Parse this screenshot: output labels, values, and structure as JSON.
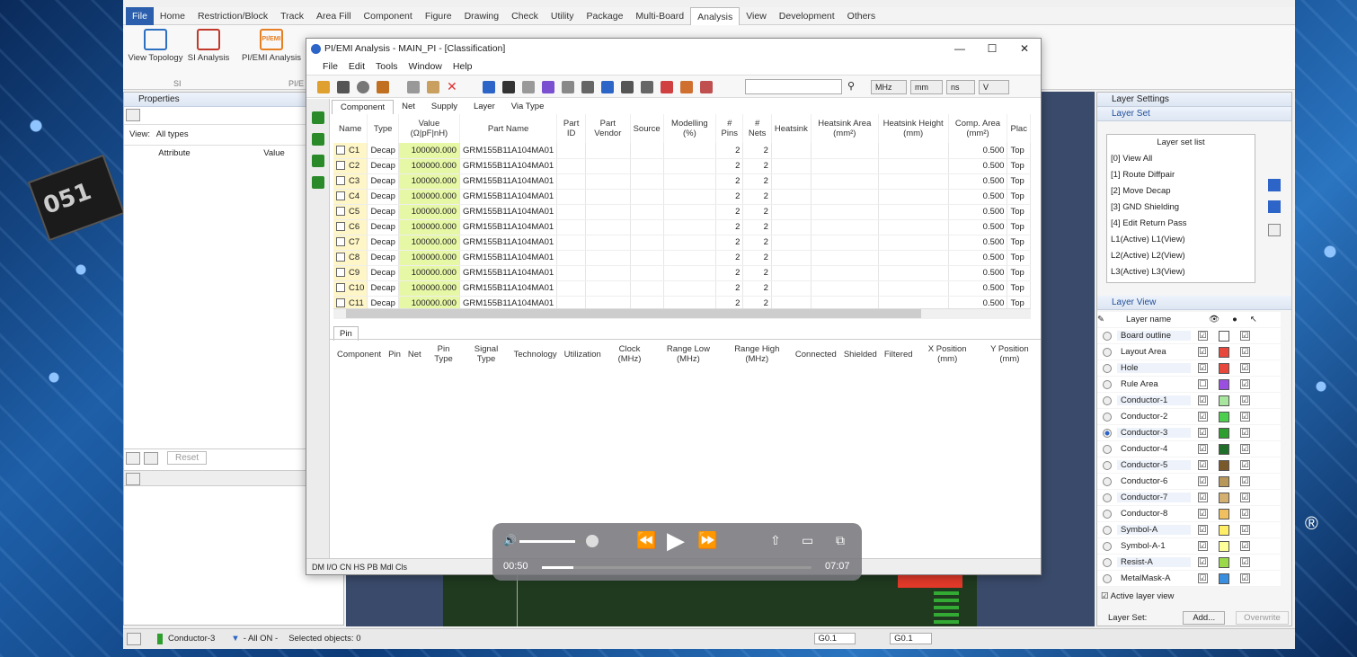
{
  "menu": {
    "tabs": [
      "File",
      "Home",
      "Restriction/Block",
      "Track",
      "Area Fill",
      "Component",
      "Figure",
      "Drawing",
      "Check",
      "Utility",
      "Package",
      "Multi-Board",
      "Analysis",
      "View",
      "Development",
      "Others"
    ],
    "active": "Analysis"
  },
  "ribbon": {
    "view_topology": "View Topology",
    "si_analysis": "SI Analysis",
    "pi_emi_analysis": "PI/EMI Analysis",
    "group_si": "SI",
    "group_pi": "PI/E"
  },
  "properties": {
    "title": "Properties",
    "view_label": "View:",
    "view_value": "All types",
    "col_attribute": "Attribute",
    "col_value": "Value",
    "reset": "Reset"
  },
  "dialog": {
    "title": "PI/EMI Analysis - MAIN_PI - [Classification]",
    "menu": [
      "File",
      "Edit",
      "Tools",
      "Window",
      "Help"
    ],
    "units": [
      "MHz",
      "mm",
      "ns",
      "V"
    ],
    "tabs": [
      "Component",
      "Net",
      "Supply",
      "Layer",
      "Via Type"
    ],
    "columns": [
      "Name",
      "Type",
      "Value (Ω|pF|nH)",
      "Part Name",
      "Part ID",
      "Part Vendor",
      "Source",
      "Modelling (%)",
      "# Pins",
      "# Nets",
      "Heatsink",
      "Heatsink Area (mm²)",
      "Heatsink Height (mm)",
      "Comp. Area (mm²)",
      "Plac"
    ],
    "rows": [
      {
        "name": "C1",
        "type": "Decap",
        "value": "100000.000",
        "part": "GRM155B11A104MA01",
        "pins": "2",
        "nets": "2",
        "area": "0.500",
        "place": "Top"
      },
      {
        "name": "C2",
        "type": "Decap",
        "value": "100000.000",
        "part": "GRM155B11A104MA01",
        "pins": "2",
        "nets": "2",
        "area": "0.500",
        "place": "Top"
      },
      {
        "name": "C3",
        "type": "Decap",
        "value": "100000.000",
        "part": "GRM155B11A104MA01",
        "pins": "2",
        "nets": "2",
        "area": "0.500",
        "place": "Top"
      },
      {
        "name": "C4",
        "type": "Decap",
        "value": "100000.000",
        "part": "GRM155B11A104MA01",
        "pins": "2",
        "nets": "2",
        "area": "0.500",
        "place": "Top"
      },
      {
        "name": "C5",
        "type": "Decap",
        "value": "100000.000",
        "part": "GRM155B11A104MA01",
        "pins": "2",
        "nets": "2",
        "area": "0.500",
        "place": "Top"
      },
      {
        "name": "C6",
        "type": "Decap",
        "value": "100000.000",
        "part": "GRM155B11A104MA01",
        "pins": "2",
        "nets": "2",
        "area": "0.500",
        "place": "Top"
      },
      {
        "name": "C7",
        "type": "Decap",
        "value": "100000.000",
        "part": "GRM155B11A104MA01",
        "pins": "2",
        "nets": "2",
        "area": "0.500",
        "place": "Top"
      },
      {
        "name": "C8",
        "type": "Decap",
        "value": "100000.000",
        "part": "GRM155B11A104MA01",
        "pins": "2",
        "nets": "2",
        "area": "0.500",
        "place": "Top"
      },
      {
        "name": "C9",
        "type": "Decap",
        "value": "100000.000",
        "part": "GRM155B11A104MA01",
        "pins": "2",
        "nets": "2",
        "area": "0.500",
        "place": "Top"
      },
      {
        "name": "C10",
        "type": "Decap",
        "value": "100000.000",
        "part": "GRM155B11A104MA01",
        "pins": "2",
        "nets": "2",
        "area": "0.500",
        "place": "Top"
      },
      {
        "name": "C11",
        "type": "Decap",
        "value": "100000.000",
        "part": "GRM155B11A104MA01",
        "pins": "2",
        "nets": "2",
        "area": "0.500",
        "place": "Top"
      }
    ],
    "pin_tab": "Pin",
    "pin_columns": [
      "Component",
      "Pin",
      "Net",
      "Pin Type",
      "Signal Type",
      "Technology",
      "Utilization",
      "Clock (MHz)",
      "Range Low (MHz)",
      "Range High (MHz)",
      "Connected",
      "Shielded",
      "Filtered",
      "X Position (mm)",
      "Y Position (mm)"
    ],
    "footer": "DM I/O CN HS PB Mdl Cls"
  },
  "layer_settings": {
    "title": "Layer Settings",
    "layer_set": "Layer Set",
    "list_header": "Layer set list",
    "sets": [
      "[0] View All",
      "[1] Route Diffpair",
      "[2] Move Decap",
      "[3] GND Shielding",
      "[4] Edit Return Pass",
      "L1(Active) L1(View)",
      "L2(Active) L2(View)",
      "L3(Active) L3(View)"
    ],
    "layer_view": "Layer View",
    "col_layer_name": "Layer name",
    "layers": [
      {
        "name": "Board outline",
        "vis": "☑",
        "sel": "☑",
        "color": "#ffffff",
        "checked_color": false,
        "active": false
      },
      {
        "name": "Layout Area",
        "vis": "☑",
        "sel": "☑",
        "color": "#e8473c",
        "active": false
      },
      {
        "name": "Hole",
        "vis": "☑",
        "sel": "☑",
        "color": "#e8473c",
        "active": false
      },
      {
        "name": "Rule Area",
        "vis": "☐",
        "sel": "☑",
        "color": "#9b4fe0",
        "active": false
      },
      {
        "name": "Conductor-1",
        "vis": "☑",
        "sel": "☑",
        "color": "#a8e6a0",
        "active": false
      },
      {
        "name": "Conductor-2",
        "vis": "☑",
        "sel": "☑",
        "color": "#4ccf4c",
        "active": false
      },
      {
        "name": "Conductor-3",
        "vis": "☑",
        "sel": "☑",
        "color": "#2e9e2e",
        "active": true
      },
      {
        "name": "Conductor-4",
        "vis": "☑",
        "sel": "☑",
        "color": "#1f6e2a",
        "active": false
      },
      {
        "name": "Conductor-5",
        "vis": "☑",
        "sel": "☑",
        "color": "#7a5a2a",
        "active": false
      },
      {
        "name": "Conductor-6",
        "vis": "☑",
        "sel": "☑",
        "color": "#b8975a",
        "active": false
      },
      {
        "name": "Conductor-7",
        "vis": "☑",
        "sel": "☑",
        "color": "#d4b070",
        "active": false
      },
      {
        "name": "Conductor-8",
        "vis": "☑",
        "sel": "☑",
        "color": "#f0c060",
        "active": false
      },
      {
        "name": "Symbol-A",
        "vis": "☑",
        "sel": "☑",
        "color": "#ffee66",
        "active": false
      },
      {
        "name": "Symbol-A-1",
        "vis": "☑",
        "sel": "☑",
        "color": "#ffff99",
        "active": false
      },
      {
        "name": "Resist-A",
        "vis": "☑",
        "sel": "☑",
        "color": "#9ad94a",
        "active": false
      },
      {
        "name": "MetalMask-A",
        "vis": "☑",
        "sel": "☑",
        "color": "#3a8ee0",
        "active": false
      }
    ],
    "active_layer_view": "Active layer view",
    "layer_set_label": "Layer Set:",
    "add": "Add...",
    "overwrite": "Overwrite"
  },
  "status": {
    "layer": "Conductor-3",
    "filter": "- All ON -",
    "selected": "Selected objects: 0",
    "grid1": "G0.1",
    "grid2": "G0.1"
  },
  "video": {
    "current": "00:50",
    "total": "07:07",
    "progress": 0.117,
    "volume": 0.75
  },
  "brand_mark": "®"
}
